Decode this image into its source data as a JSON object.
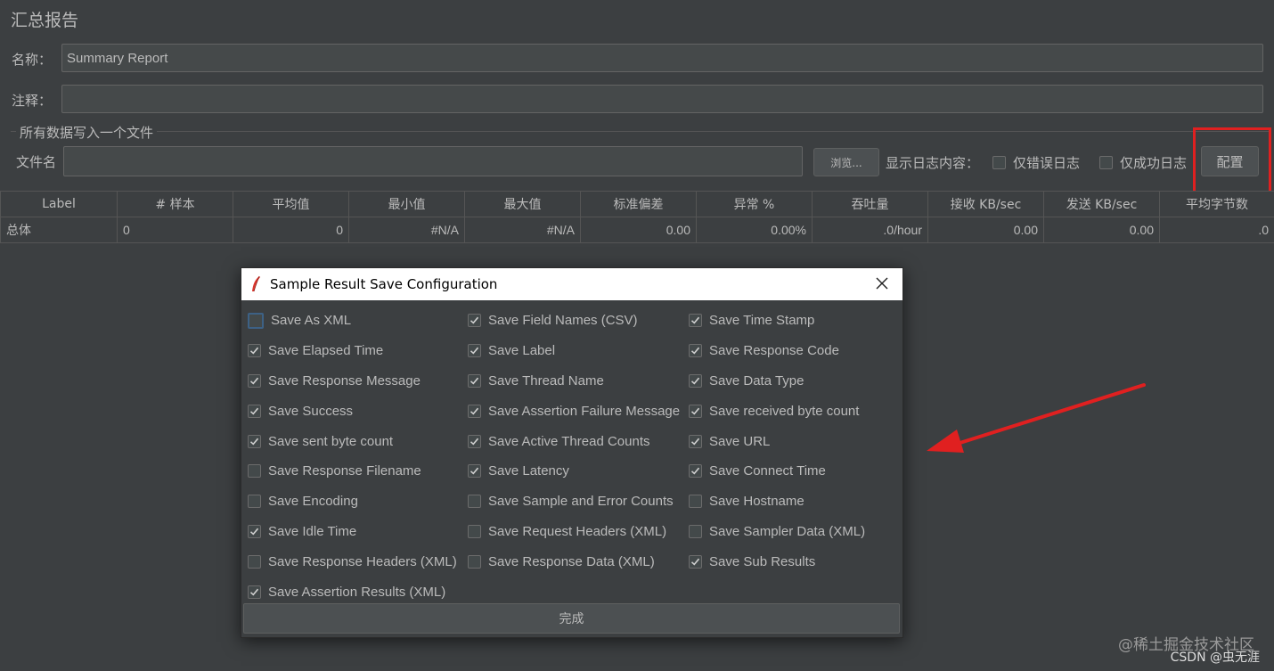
{
  "panel": {
    "title": "汇总报告",
    "name_label": "名称：",
    "name_value": "Summary Report",
    "comment_label": "注释：",
    "comment_value": "",
    "file_section_title": "所有数据写入一个文件",
    "filename_label": "文件名",
    "filename_value": "",
    "browse_label": "浏览...",
    "log_content_label": "显示日志内容：",
    "errors_only_label": "仅错误日志",
    "success_only_label": "仅成功日志",
    "configure_label": "配置"
  },
  "table": {
    "columns": [
      "Label",
      "# 样本",
      "平均值",
      "最小值",
      "最大值",
      "标准偏差",
      "异常 %",
      "吞吐量",
      "接收 KB/sec",
      "发送 KB/sec",
      "平均字节数"
    ],
    "rows": [
      [
        "总体",
        "0",
        "0",
        "#N/A",
        "#N/A",
        "0.00",
        "0.00%",
        ".0/hour",
        "0.00",
        "0.00",
        ".0"
      ]
    ]
  },
  "dialog": {
    "title": "Sample Result Save Configuration",
    "done_label": "完成",
    "options": [
      {
        "label": "Save As XML",
        "checked": false
      },
      {
        "label": "Save Field Names (CSV)",
        "checked": true
      },
      {
        "label": "Save Time Stamp",
        "checked": true
      },
      {
        "label": "Save Elapsed Time",
        "checked": true
      },
      {
        "label": "Save Label",
        "checked": true
      },
      {
        "label": "Save Response Code",
        "checked": true
      },
      {
        "label": "Save Response Message",
        "checked": true
      },
      {
        "label": "Save Thread Name",
        "checked": true
      },
      {
        "label": "Save Data Type",
        "checked": true
      },
      {
        "label": "Save Success",
        "checked": true
      },
      {
        "label": "Save Assertion Failure Message",
        "checked": true
      },
      {
        "label": "Save received byte count",
        "checked": true
      },
      {
        "label": "Save sent byte count",
        "checked": true
      },
      {
        "label": "Save Active Thread Counts",
        "checked": true
      },
      {
        "label": "Save URL",
        "checked": true
      },
      {
        "label": "Save Response Filename",
        "checked": false
      },
      {
        "label": "Save Latency",
        "checked": true
      },
      {
        "label": "Save Connect Time",
        "checked": true
      },
      {
        "label": "Save Encoding",
        "checked": false
      },
      {
        "label": "Save Sample and Error Counts",
        "checked": false
      },
      {
        "label": "Save Hostname",
        "checked": false
      },
      {
        "label": "Save Idle Time",
        "checked": true
      },
      {
        "label": "Save Request Headers (XML)",
        "checked": false
      },
      {
        "label": "Save Sampler Data (XML)",
        "checked": false
      },
      {
        "label": "Save Response Headers (XML)",
        "checked": false
      },
      {
        "label": "Save Response Data (XML)",
        "checked": false
      },
      {
        "label": "Save Sub Results",
        "checked": true
      },
      {
        "label": "Save Assertion Results (XML)",
        "checked": true
      }
    ]
  },
  "watermark": {
    "line1": "@稀土掘金技术社区",
    "line2": "CSDN @虫无涯"
  },
  "colors": {
    "background": "#3c3f41",
    "highlight": "#e02020",
    "arrow": "#e02020",
    "focus": "#3d6185"
  }
}
